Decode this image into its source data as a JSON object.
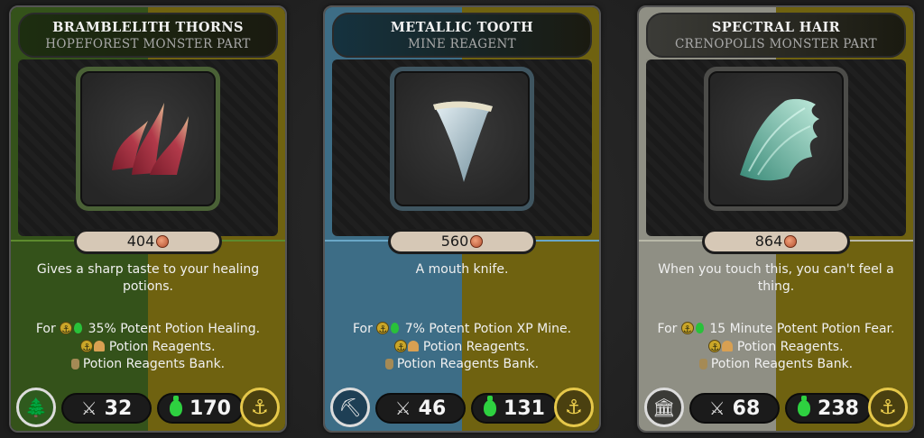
{
  "cards": [
    {
      "title": "BRAMBLELITH THORNS",
      "subtitle": "HOPEFOREST MONSTER PART",
      "art": "thorns-icon",
      "price": "404",
      "description": "Gives a sharp taste to your healing potions.",
      "effects": [
        "35% Potent Potion Healing.",
        "Potion Reagents.",
        "Potion Reagents Bank."
      ],
      "effect_prefix": "For",
      "location_icon": "tree-icon",
      "attack": "32",
      "potion": "170",
      "colors": {
        "left": "#34521a",
        "right": "#6f6210"
      }
    },
    {
      "title": "METALLIC TOOTH",
      "subtitle": "MINE REAGENT",
      "art": "tooth-icon",
      "price": "560",
      "description": "A mouth knife.",
      "effects": [
        "7% Potent Potion XP Mine.",
        "Potion Reagents.",
        "Potion Reagents Bank."
      ],
      "effect_prefix": "For",
      "location_icon": "mine-cart-icon",
      "attack": "46",
      "potion": "131",
      "colors": {
        "left": "#3d6d86",
        "right": "#6f6210"
      }
    },
    {
      "title": "SPECTRAL HAIR",
      "subtitle": "CRENOPOLIS MONSTER PART",
      "art": "hair-icon",
      "price": "864",
      "description": "When you touch this, you can't feel a thing.",
      "effects": [
        "15 Minute Potent Potion Fear.",
        "Potion Reagents.",
        "Potion Reagents Bank."
      ],
      "effect_prefix": "For",
      "location_icon": "building-icon",
      "attack": "68",
      "potion": "238",
      "colors": {
        "left": "#8f8f84",
        "right": "#6f6210"
      }
    }
  ]
}
